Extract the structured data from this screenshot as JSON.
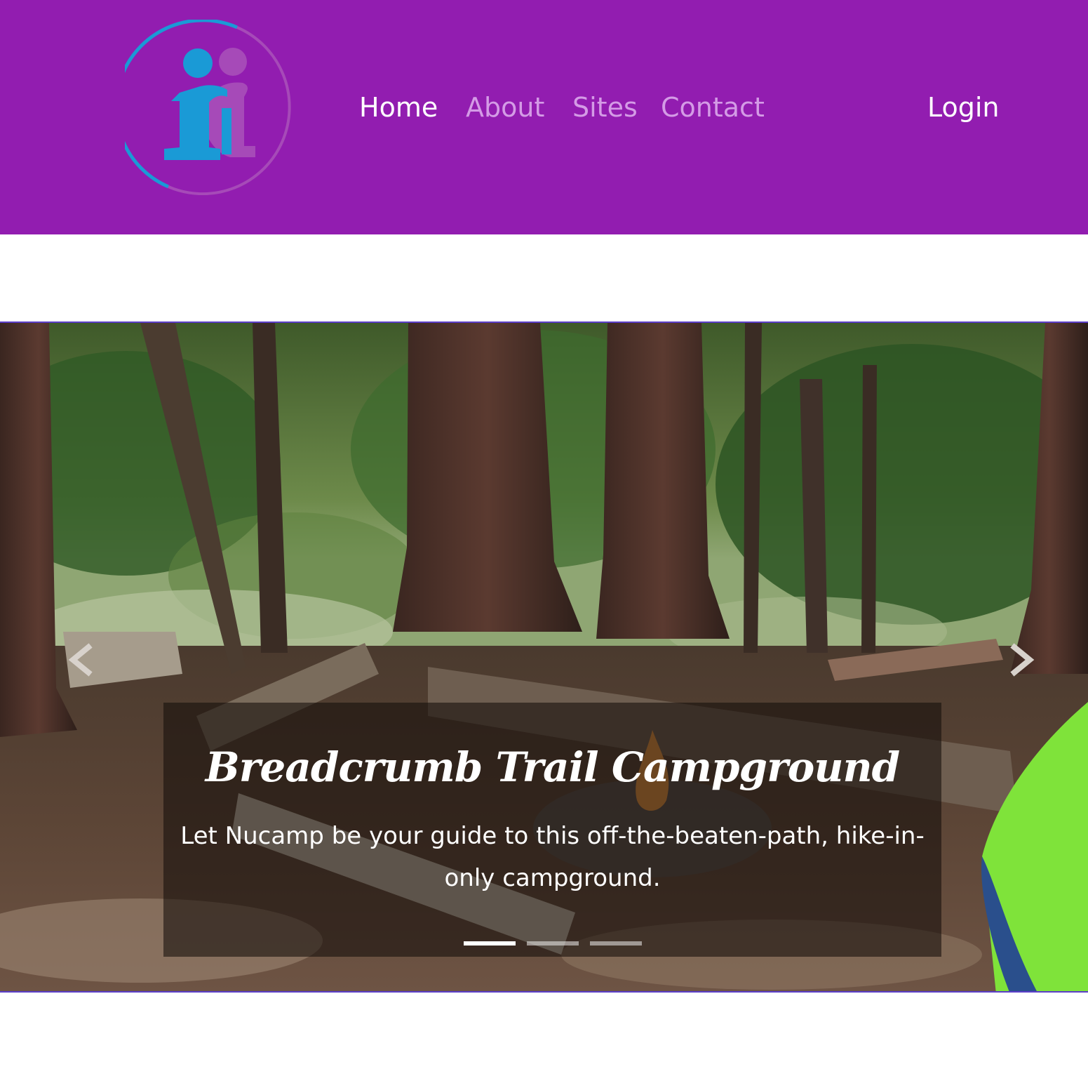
{
  "nav": {
    "links": [
      {
        "label": "Home",
        "active": true
      },
      {
        "label": "About",
        "active": false
      },
      {
        "label": "Sites",
        "active": false
      },
      {
        "label": "Contact",
        "active": false
      }
    ],
    "login_label": "Login"
  },
  "carousel": {
    "slides": [
      {
        "title": "Breadcrumb Trail Campground",
        "text": "Let Nucamp be your guide to this off-the-beaten-path, hike-in-only campground."
      }
    ],
    "indicator_count": 3,
    "active_index": 0,
    "prev_icon": "chevron-left-icon",
    "next_icon": "chevron-right-icon"
  },
  "colors": {
    "navbar_bg": "#921db0",
    "nav_active": "#ffffff",
    "nav_muted": "#d49be6",
    "logo_blue": "#1a9ad6",
    "logo_purple": "#a64ab8"
  }
}
